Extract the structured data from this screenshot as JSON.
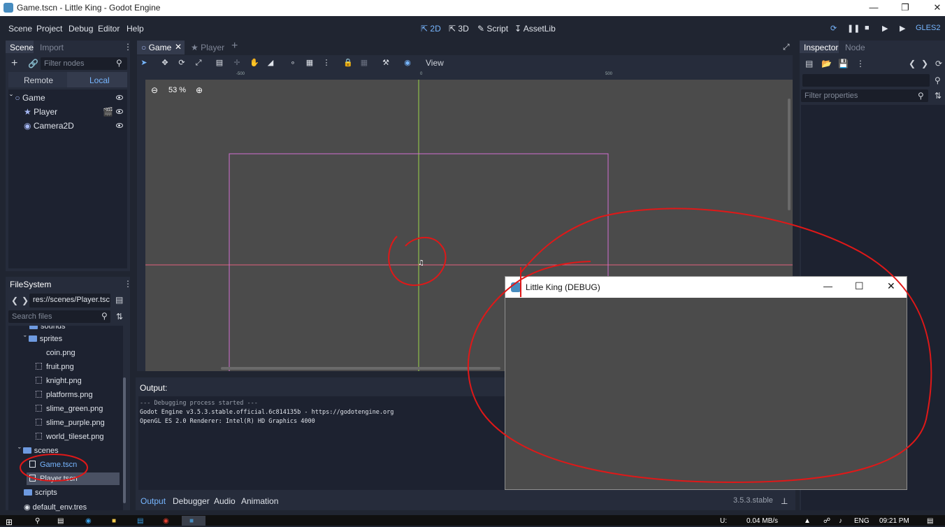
{
  "window": {
    "title": "Game.tscn - Little King - Godot Engine"
  },
  "menu": {
    "items": [
      "Scene",
      "Project",
      "Debug",
      "Editor",
      "Help"
    ]
  },
  "workspaces": {
    "2d": "2D",
    "3d": "3D",
    "script": "Script",
    "assetlib": "AssetLib"
  },
  "renderer": "GLES2",
  "scene_dock": {
    "tabs": [
      "Scene",
      "Import"
    ],
    "filter_placeholder": "Filter nodes",
    "remote": "Remote",
    "local": "Local",
    "nodes": [
      {
        "label": "Game"
      },
      {
        "label": "Player"
      },
      {
        "label": "Camera2D"
      }
    ]
  },
  "filesystem": {
    "title": "FileSystem",
    "path": "res://scenes/Player.tsc",
    "search_placeholder": "Search files",
    "items": [
      {
        "label": "sounds"
      },
      {
        "label": "sprites"
      },
      {
        "label": "coin.png"
      },
      {
        "label": "fruit.png"
      },
      {
        "label": "knight.png"
      },
      {
        "label": "platforms.png"
      },
      {
        "label": "slime_green.png"
      },
      {
        "label": "slime_purple.png"
      },
      {
        "label": "world_tileset.png"
      },
      {
        "label": "scenes"
      },
      {
        "label": "Game.tscn"
      },
      {
        "label": "Player.tscn"
      },
      {
        "label": "scripts"
      },
      {
        "label": "default_env.tres"
      }
    ]
  },
  "editor_tabs": [
    "Game",
    "Player"
  ],
  "toolbar": {
    "view": "View"
  },
  "viewport": {
    "zoom": "53 %",
    "ruler_marks": [
      "-500",
      "0",
      "500"
    ]
  },
  "output": {
    "title": "Output:",
    "lines": [
      "--- Debugging process started ---",
      "Godot Engine v3.5.3.stable.official.6c814135b - https://godotengine.org",
      "OpenGL ES 2.0 Renderer: Intel(R) HD Graphics 4000"
    ]
  },
  "bottom_tabs": [
    "Output",
    "Debugger",
    "Audio",
    "Animation"
  ],
  "version": "3.5.3.stable",
  "inspector": {
    "tabs": [
      "Inspector",
      "Node"
    ],
    "filter_placeholder": "Filter properties"
  },
  "debug_window": {
    "title": "Little King (DEBUG)"
  },
  "taskbar": {
    "net": "0.04 MB/s",
    "net_label": "U:",
    "lang": "ENG",
    "time": "09:21 PM"
  },
  "colors": {
    "accent": "#77b6ff",
    "annotation": "#e01818",
    "bg": "#202531",
    "panel": "#262c3b"
  }
}
